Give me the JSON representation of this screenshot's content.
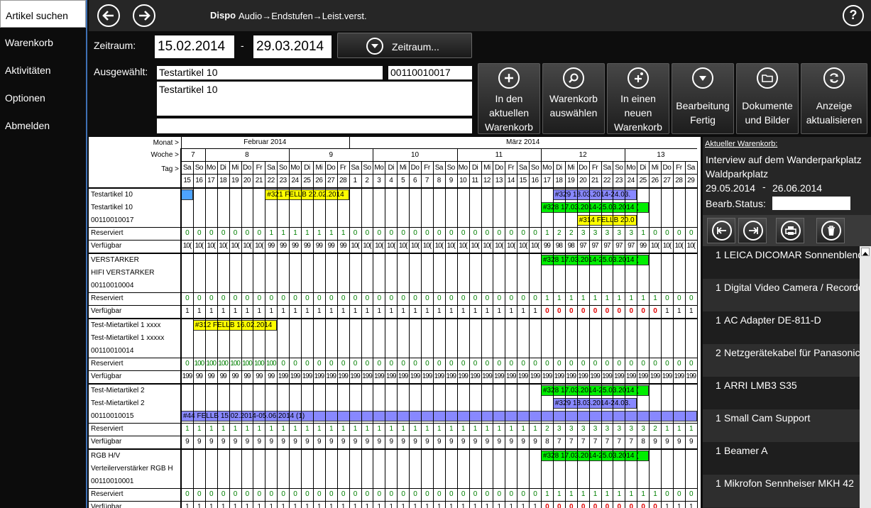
{
  "nav": [
    {
      "label": "Artikel suchen",
      "active": true
    },
    {
      "label": "Warenkorb",
      "active": false
    },
    {
      "label": "Aktivitäten",
      "active": false
    },
    {
      "label": "Optionen",
      "active": false
    },
    {
      "label": "Abmelden",
      "active": false
    }
  ],
  "topbar": {
    "title": "Dispo",
    "breadcrumb": "Audio→Endstufen→Leist.verst.",
    "help": "?"
  },
  "filters": {
    "zeitraum_label": "Zeitraum:",
    "date_from": "15.02.2014",
    "dash": "-",
    "date_to": "29.03.2014",
    "zeitraum_button": "Zeitraum...",
    "ausgewaehlt_label": "Ausgewählt:",
    "article_name": "Testartikel 10",
    "article_number": "00110010017",
    "article_description": "Testartikel 10",
    "extra": ""
  },
  "actions": [
    {
      "label": "In den\naktuellen\nWarenkorb",
      "icon": "plus-icon"
    },
    {
      "label": "Warenkorb\nauswählen",
      "icon": "search-icon"
    },
    {
      "label": "In einen\nneuen\nWarenkorb",
      "icon": "add-new-icon"
    },
    {
      "label": "Bearbeitung\nFertig",
      "icon": "chevron-down-icon"
    },
    {
      "label": "Dokumente\nund Bilder",
      "icon": "folder-icon"
    },
    {
      "label": "Anzeige\naktualisieren",
      "icon": "refresh-icon"
    }
  ],
  "grid": {
    "monat_label": "Monat >",
    "woche_label": "Woche >",
    "tag_label": "Tag >",
    "months": [
      {
        "label": "Februar 2014",
        "days": 14
      },
      {
        "label": "März 2014",
        "days": 29
      }
    ],
    "weeks": [
      {
        "label": "7",
        "days": 2
      },
      {
        "label": "8",
        "days": 7
      },
      {
        "label": "9",
        "days": 7
      },
      {
        "label": "10",
        "days": 7
      },
      {
        "label": "11",
        "days": 7
      },
      {
        "label": "12",
        "days": 7
      },
      {
        "label": "13",
        "days": 6
      }
    ],
    "weekdays": [
      "Sa",
      "So",
      "Mo",
      "Di",
      "Mi",
      "Do",
      "Fr",
      "Sa",
      "So",
      "Mo",
      "Di",
      "Mi",
      "Do",
      "Fr",
      "Sa",
      "So",
      "Mo",
      "Di",
      "Mi",
      "Do",
      "Fr",
      "Sa",
      "So",
      "Mo",
      "Di",
      "Mi",
      "Do",
      "Fr",
      "Sa",
      "So",
      "Mo",
      "Di",
      "Mi",
      "Do",
      "Fr",
      "Sa",
      "So",
      "Mo",
      "Di",
      "Mi",
      "Do",
      "Fr",
      "Sa"
    ],
    "daynums": [
      "15",
      "16",
      "17",
      "18",
      "19",
      "20",
      "21",
      "22",
      "23",
      "24",
      "25",
      "26",
      "27",
      "28",
      "1",
      "2",
      "3",
      "4",
      "5",
      "6",
      "7",
      "8",
      "9",
      "10",
      "11",
      "12",
      "13",
      "14",
      "15",
      "16",
      "17",
      "18",
      "19",
      "20",
      "21",
      "22",
      "23",
      "24",
      "25",
      "26",
      "27",
      "28",
      "29"
    ],
    "reserviert_label": "Reserviert",
    "verfuegbar_label": "Verfügbar",
    "articles": [
      {
        "lines": [
          "Testartikel 10",
          "Testartikel 10",
          "00110010017"
        ],
        "bars": [
          {
            "text": "",
            "color": "#4da3ff",
            "line": 0,
            "start": 0,
            "end": 0
          },
          {
            "text": "#321 FELLB 22.02.2014",
            "color": "#ffff00",
            "line": 0,
            "start": 7,
            "end": 13
          },
          {
            "text": "#329 18.03.2014-24.03.",
            "color": "#8888ff",
            "line": 0,
            "start": 31,
            "end": 37
          },
          {
            "text": "#328 17.03.2014-25.03.2014 (",
            "color": "#00ee00",
            "line": 1,
            "start": 30,
            "end": 38
          },
          {
            "text": "#314 FELLB 20.0",
            "color": "#ffff00",
            "line": 2,
            "start": 33,
            "end": 37
          }
        ],
        "reserviert": [
          "0",
          "0",
          "0",
          "0",
          "0",
          "0",
          "0",
          "1",
          "1",
          "1",
          "1",
          "1",
          "1",
          "1",
          "0",
          "0",
          "0",
          "0",
          "0",
          "0",
          "0",
          "0",
          "0",
          "0",
          "0",
          "0",
          "0",
          "0",
          "0",
          "0",
          "1",
          "2",
          "2",
          "3",
          "3",
          "3",
          "3",
          "3",
          "1",
          "0",
          "0",
          "0",
          "0"
        ],
        "verfuegbar": [
          "10(",
          "10(",
          "10(",
          "10(",
          "10(",
          "10(",
          "10(",
          "99",
          "99",
          "99",
          "99",
          "99",
          "99",
          "99",
          "10(",
          "10(",
          "10(",
          "10(",
          "10(",
          "10(",
          "10(",
          "10(",
          "10(",
          "10(",
          "10(",
          "10(",
          "10(",
          "10(",
          "10(",
          "10(",
          "99",
          "98",
          "98",
          "97",
          "97",
          "97",
          "97",
          "97",
          "99",
          "10(",
          "10(",
          "10(",
          "10("
        ],
        "verf_red": []
      },
      {
        "lines": [
          "VERSTÄRKER",
          "HIFI VERSTÄRKER",
          "00110010004"
        ],
        "bars": [
          {
            "text": "#328 17.03.2014-25.03.2014 (",
            "color": "#00ee00",
            "line": 0,
            "start": 30,
            "end": 38
          }
        ],
        "reserviert": [
          "0",
          "0",
          "0",
          "0",
          "0",
          "0",
          "0",
          "0",
          "0",
          "0",
          "0",
          "0",
          "0",
          "0",
          "0",
          "0",
          "0",
          "0",
          "0",
          "0",
          "0",
          "0",
          "0",
          "0",
          "0",
          "0",
          "0",
          "0",
          "0",
          "0",
          "1",
          "1",
          "1",
          "1",
          "1",
          "1",
          "1",
          "1",
          "1",
          "1",
          "0",
          "0",
          "0"
        ],
        "verfuegbar": [
          "1",
          "1",
          "1",
          "1",
          "1",
          "1",
          "1",
          "1",
          "1",
          "1",
          "1",
          "1",
          "1",
          "1",
          "1",
          "1",
          "1",
          "1",
          "1",
          "1",
          "1",
          "1",
          "1",
          "1",
          "1",
          "1",
          "1",
          "1",
          "1",
          "1",
          "0",
          "0",
          "0",
          "0",
          "0",
          "0",
          "0",
          "0",
          "0",
          "0",
          "1",
          "1",
          "1"
        ],
        "verf_red": [
          30,
          31,
          32,
          33,
          34,
          35,
          36,
          37,
          38,
          39
        ]
      },
      {
        "lines": [
          "Test-Mietartikel 1 xxxx",
          "Test-Mietartikel 1 xxxxx",
          "00110010014"
        ],
        "bars": [
          {
            "text": "#312 FELLB 16.02.2014",
            "color": "#ffff00",
            "line": 0,
            "start": 1,
            "end": 7
          }
        ],
        "reserviert": [
          "0",
          "100",
          "100",
          "100",
          "100",
          "100",
          "100",
          "100",
          "0",
          "0",
          "0",
          "0",
          "0",
          "0",
          "0",
          "0",
          "0",
          "0",
          "0",
          "0",
          "0",
          "0",
          "0",
          "0",
          "0",
          "0",
          "0",
          "0",
          "0",
          "0",
          "0",
          "0",
          "0",
          "0",
          "0",
          "0",
          "0",
          "0",
          "0",
          "0",
          "0",
          "0",
          "0"
        ],
        "verfuegbar": [
          "199",
          "99",
          "99",
          "99",
          "99",
          "99",
          "99",
          "99",
          "199",
          "199",
          "199",
          "199",
          "199",
          "199",
          "199",
          "199",
          "199",
          "199",
          "199",
          "199",
          "199",
          "199",
          "199",
          "199",
          "199",
          "199",
          "199",
          "199",
          "199",
          "199",
          "199",
          "199",
          "199",
          "199",
          "199",
          "199",
          "199",
          "199",
          "199",
          "199",
          "199",
          "199",
          "199"
        ],
        "verf_red": []
      },
      {
        "lines": [
          "Test-Mietartikel 2",
          "Test-Mietartikel 2",
          "00110010015"
        ],
        "bars": [
          {
            "text": "#328 17.03.2014-25.03.2014 (",
            "color": "#00ee00",
            "line": 0,
            "start": 30,
            "end": 38
          },
          {
            "text": "#329 18.03.2014-24.03.",
            "color": "#8888ff",
            "line": 1,
            "start": 31,
            "end": 37
          },
          {
            "text": "#44 FELLB 15.02.2014-05.06.2014 (1)",
            "color": "#8888ff",
            "line": 2,
            "start": 0,
            "end": 42
          }
        ],
        "reserviert": [
          "1",
          "1",
          "1",
          "1",
          "1",
          "1",
          "1",
          "1",
          "1",
          "1",
          "1",
          "1",
          "1",
          "1",
          "1",
          "1",
          "1",
          "1",
          "1",
          "1",
          "1",
          "1",
          "1",
          "1",
          "1",
          "1",
          "1",
          "1",
          "1",
          "1",
          "2",
          "3",
          "3",
          "3",
          "3",
          "3",
          "3",
          "3",
          "3",
          "2",
          "1",
          "1",
          "1"
        ],
        "verfuegbar": [
          "9",
          "9",
          "9",
          "9",
          "9",
          "9",
          "9",
          "9",
          "9",
          "9",
          "9",
          "9",
          "9",
          "9",
          "9",
          "9",
          "9",
          "9",
          "9",
          "9",
          "9",
          "9",
          "9",
          "9",
          "9",
          "9",
          "9",
          "9",
          "9",
          "9",
          "8",
          "7",
          "7",
          "7",
          "7",
          "7",
          "7",
          "7",
          "8",
          "9",
          "9",
          "9",
          "9"
        ],
        "verf_red": []
      },
      {
        "lines": [
          "RGB H/V",
          "Verteilerverstärker RGB H",
          "00110010001"
        ],
        "bars": [
          {
            "text": "#328 17.03.2014-25.03.2014 (",
            "color": "#00ee00",
            "line": 0,
            "start": 30,
            "end": 38
          }
        ],
        "reserviert": [
          "0",
          "0",
          "0",
          "0",
          "0",
          "0",
          "0",
          "0",
          "0",
          "0",
          "0",
          "0",
          "0",
          "0",
          "0",
          "0",
          "0",
          "0",
          "0",
          "0",
          "0",
          "0",
          "0",
          "0",
          "0",
          "0",
          "0",
          "0",
          "0",
          "0",
          "1",
          "1",
          "1",
          "1",
          "1",
          "1",
          "1",
          "1",
          "1",
          "1",
          "0",
          "0",
          "0"
        ],
        "verfuegbar": [
          "1",
          "1",
          "1",
          "1",
          "1",
          "1",
          "1",
          "1",
          "1",
          "1",
          "1",
          "1",
          "1",
          "1",
          "1",
          "1",
          "1",
          "1",
          "1",
          "1",
          "1",
          "1",
          "1",
          "1",
          "1",
          "1",
          "1",
          "1",
          "1",
          "1",
          "0",
          "0",
          "0",
          "0",
          "0",
          "0",
          "0",
          "0",
          "0",
          "0",
          "1",
          "1",
          "1"
        ],
        "verf_red": [
          30,
          31,
          32,
          33,
          34,
          35,
          36,
          37,
          38,
          39
        ]
      }
    ]
  },
  "cart": {
    "title": "Aktueller Warenkorb:",
    "name_line1": "Interview auf dem Wanderparkplatz",
    "name_line2": "Waldparkplatz",
    "date_from": "29.05.2014",
    "dash": "-",
    "date_to": "26.06.2014",
    "status_label": "Bearb.Status:",
    "status_value": "",
    "items": [
      {
        "qty": "1",
        "name": "LEICA DICOMAR Sonnenblende"
      },
      {
        "qty": "1",
        "name": "Digital Video Camera / Recorder"
      },
      {
        "qty": "1",
        "name": "AC Adapter DE-811-D"
      },
      {
        "qty": "2",
        "name": "Netzgerätekabel für Panasonic"
      },
      {
        "qty": "1",
        "name": "ARRI LMB3 S35"
      },
      {
        "qty": "1",
        "name": "Small Cam Support"
      },
      {
        "qty": "1",
        "name": "Beamer A"
      },
      {
        "qty": "1",
        "name": "Mikrofon Sennheiser MKH 42"
      }
    ]
  },
  "colors": {
    "nav_border": "#3e70b5",
    "reserved_text": "#008000",
    "zero_red": "#e00000"
  }
}
